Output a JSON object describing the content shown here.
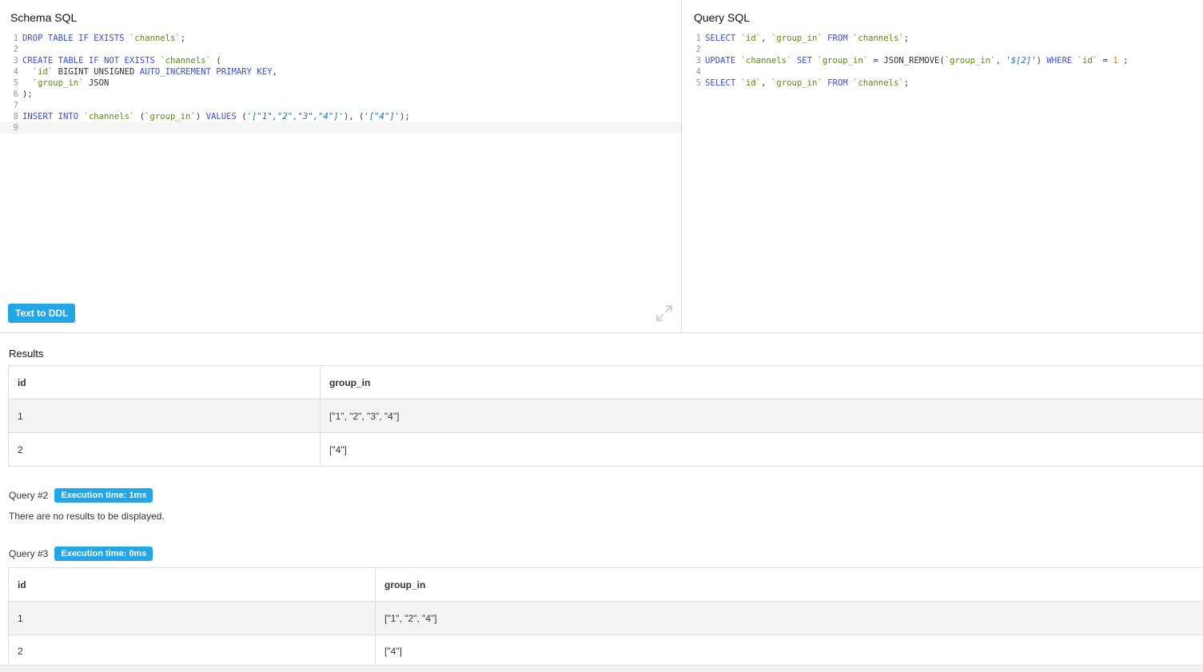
{
  "schema": {
    "title": "Schema SQL",
    "lines": [
      {
        "num": "1",
        "tokens": [
          [
            "k",
            "DROP TABLE IF EXISTS "
          ],
          [
            "b",
            "`channels`"
          ],
          [
            "p",
            ";"
          ]
        ]
      },
      {
        "num": "2",
        "tokens": []
      },
      {
        "num": "3",
        "tokens": [
          [
            "k",
            "CREATE TABLE IF NOT EXISTS "
          ],
          [
            "b",
            "`channels`"
          ],
          [
            "p",
            " ("
          ]
        ]
      },
      {
        "num": "4",
        "tokens": [
          [
            "p",
            "  "
          ],
          [
            "b",
            "`id`"
          ],
          [
            "p",
            " BIGINT UNSIGNED "
          ],
          [
            "k",
            "AUTO_INCREMENT PRIMARY KEY"
          ],
          [
            "p",
            ","
          ]
        ]
      },
      {
        "num": "5",
        "tokens": [
          [
            "p",
            "  "
          ],
          [
            "b",
            "`group_in`"
          ],
          [
            "p",
            " JSON"
          ]
        ]
      },
      {
        "num": "6",
        "tokens": [
          [
            "p",
            ");"
          ]
        ]
      },
      {
        "num": "7",
        "tokens": []
      },
      {
        "num": "8",
        "tokens": [
          [
            "k",
            "INSERT INTO "
          ],
          [
            "b",
            "`channels`"
          ],
          [
            "p",
            " ("
          ],
          [
            "b",
            "`group_in`"
          ],
          [
            "p",
            ") "
          ],
          [
            "k",
            "VALUES"
          ],
          [
            "p",
            " ("
          ],
          [
            "s",
            "'[\"1\",\"2\",\"3\",\"4\"]'"
          ],
          [
            "p",
            "), ("
          ],
          [
            "s",
            "'[\"4\"]'"
          ],
          [
            "p",
            ");"
          ]
        ]
      },
      {
        "num": "9",
        "tokens": [],
        "active": true
      }
    ],
    "text_to_ddl_label": "Text to DDL",
    "expand_icon": "expand-icon"
  },
  "query": {
    "title": "Query SQL",
    "lines": [
      {
        "num": "1",
        "tokens": [
          [
            "k",
            "SELECT "
          ],
          [
            "b",
            "`id`"
          ],
          [
            "p",
            ", "
          ],
          [
            "b",
            "`group_in`"
          ],
          [
            "k",
            " FROM "
          ],
          [
            "b",
            "`channels`"
          ],
          [
            "p",
            ";"
          ]
        ]
      },
      {
        "num": "2",
        "tokens": []
      },
      {
        "num": "3",
        "tokens": [
          [
            "k",
            "UPDATE "
          ],
          [
            "b",
            "`channels`"
          ],
          [
            "k",
            " SET "
          ],
          [
            "b",
            "`group_in`"
          ],
          [
            "p",
            " = JSON_REMOVE("
          ],
          [
            "b",
            "`group_in`"
          ],
          [
            "p",
            ", "
          ],
          [
            "s",
            "'$[2]'"
          ],
          [
            "p",
            ") "
          ],
          [
            "k",
            "WHERE "
          ],
          [
            "b",
            "`id`"
          ],
          [
            "p",
            " = "
          ],
          [
            "n",
            "1"
          ],
          [
            "p",
            " ;"
          ]
        ]
      },
      {
        "num": "4",
        "tokens": []
      },
      {
        "num": "5",
        "tokens": [
          [
            "k",
            "SELECT "
          ],
          [
            "b",
            "`id`"
          ],
          [
            "p",
            ", "
          ],
          [
            "b",
            "`group_in`"
          ],
          [
            "k",
            " FROM "
          ],
          [
            "b",
            "`channels`"
          ],
          [
            "p",
            ";"
          ]
        ]
      }
    ]
  },
  "results": {
    "title": "Results",
    "query1": {
      "columns": [
        "id",
        "group_in"
      ],
      "rows": [
        [
          "1",
          "[\"1\", \"2\", \"3\", \"4\"]"
        ],
        [
          "2",
          "[\"4\"]"
        ]
      ]
    },
    "query2": {
      "label": "Query #2",
      "badge": "Execution time: 1ms",
      "message": "There are no results to be displayed."
    },
    "query3": {
      "label": "Query #3",
      "badge": "Execution time: 0ms",
      "columns": [
        "id",
        "group_in"
      ],
      "rows": [
        [
          "1",
          "[\"1\", \"2\", \"4\"]"
        ],
        [
          "2",
          "[\"4\"]"
        ]
      ]
    }
  },
  "colors": {
    "accent": "#23a6e8",
    "keyword": "#3a4fd6",
    "identifier": "#5a8a10",
    "string": "#1e6db3",
    "number": "#d47a1a"
  }
}
